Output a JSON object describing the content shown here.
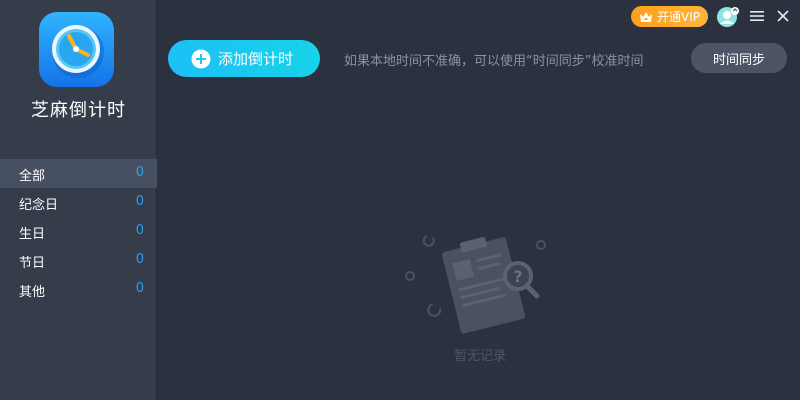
{
  "app": {
    "name": "芝麻倒计时"
  },
  "categories": [
    {
      "label": "全部",
      "count": "0"
    },
    {
      "label": "纪念日",
      "count": "0"
    },
    {
      "label": "生日",
      "count": "0"
    },
    {
      "label": "节日",
      "count": "0"
    },
    {
      "label": "其他",
      "count": "0"
    }
  ],
  "topbar": {
    "vip_label": "开通VIP"
  },
  "toolbar": {
    "add_label": "添加倒计时",
    "hint": "如果本地时间不准确，可以使用“时间同步”校准时间",
    "sync_label": "时间同步"
  },
  "empty": {
    "text": "暂无记录"
  },
  "colors": {
    "accent": "#1ec0f6",
    "count": "#2d9df4",
    "vip": "#ffa726",
    "sidebar": "#353c4a",
    "main": "#2b313f"
  },
  "icons": [
    "clock-logo-icon",
    "crown-icon",
    "avatar-icon",
    "menu-icon",
    "close-icon",
    "plus-circle-icon",
    "empty-clipboard-icon"
  ]
}
